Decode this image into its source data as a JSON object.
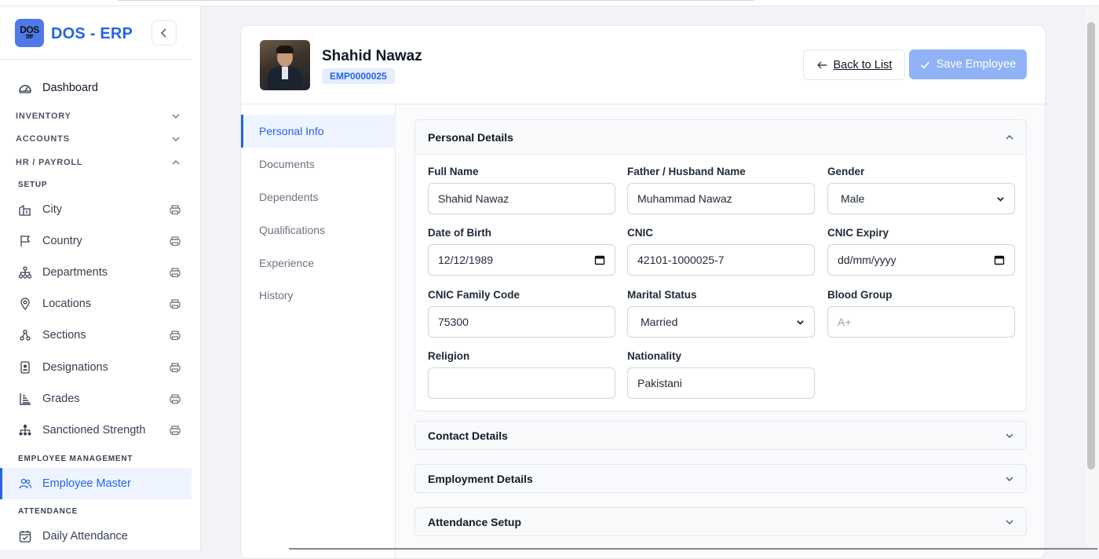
{
  "app": {
    "name": "DOS - ERP",
    "logo_text": "DOS",
    "logo_sub": "ERP"
  },
  "sidebar": {
    "dashboard": "Dashboard",
    "sections": {
      "inventory": "INVENTORY",
      "accounts": "ACCOUNTS",
      "hr_payroll": "HR / PAYROLL"
    },
    "setup_heading": "SETUP",
    "setup_items": [
      {
        "label": "City",
        "icon": "city-icon"
      },
      {
        "label": "Country",
        "icon": "flag-icon"
      },
      {
        "label": "Departments",
        "icon": "org-chart-icon"
      },
      {
        "label": "Locations",
        "icon": "map-pin-icon"
      },
      {
        "label": "Sections",
        "icon": "sections-icon"
      },
      {
        "label": "Designations",
        "icon": "id-badge-icon"
      },
      {
        "label": "Grades",
        "icon": "grades-icon"
      },
      {
        "label": "Sanctioned Strength",
        "icon": "hierarchy-icon"
      }
    ],
    "employee_mgmt_heading": "EMPLOYEE MANAGEMENT",
    "employee_master": "Employee Master",
    "attendance_heading": "ATTENDANCE",
    "daily_attendance": "Daily Attendance"
  },
  "header": {
    "employee_name": "Shahid Nawaz",
    "employee_code": "EMP0000025",
    "back_label": "Back to List",
    "save_label": "Save Employee"
  },
  "tabs": [
    "Personal Info",
    "Documents",
    "Dependents",
    "Qualifications",
    "Experience",
    "History"
  ],
  "personal_details": {
    "title": "Personal Details",
    "full_name": {
      "label": "Full Name",
      "value": "Shahid Nawaz"
    },
    "father_name": {
      "label": "Father / Husband Name",
      "value": "Muhammad Nawaz"
    },
    "gender": {
      "label": "Gender",
      "value": "Male"
    },
    "dob": {
      "label": "Date of Birth",
      "value": "12/12/1989"
    },
    "cnic": {
      "label": "CNIC",
      "value": "42101-1000025-7"
    },
    "cnic_expiry": {
      "label": "CNIC Expiry",
      "placeholder": "dd/mm/yyyy"
    },
    "cnic_family_code": {
      "label": "CNIC Family Code",
      "value": "75300"
    },
    "marital_status": {
      "label": "Marital Status",
      "value": "Married"
    },
    "blood_group": {
      "label": "Blood Group",
      "placeholder": "A+"
    },
    "religion": {
      "label": "Religion",
      "value": ""
    },
    "nationality": {
      "label": "Nationality",
      "value": "Pakistani"
    }
  },
  "collapsed_sections": [
    "Contact Details",
    "Employment Details",
    "Attendance Setup"
  ],
  "colors": {
    "accent": "#2563eb",
    "save_button": "#8fb3f6",
    "active_bg": "#eef4ff"
  }
}
